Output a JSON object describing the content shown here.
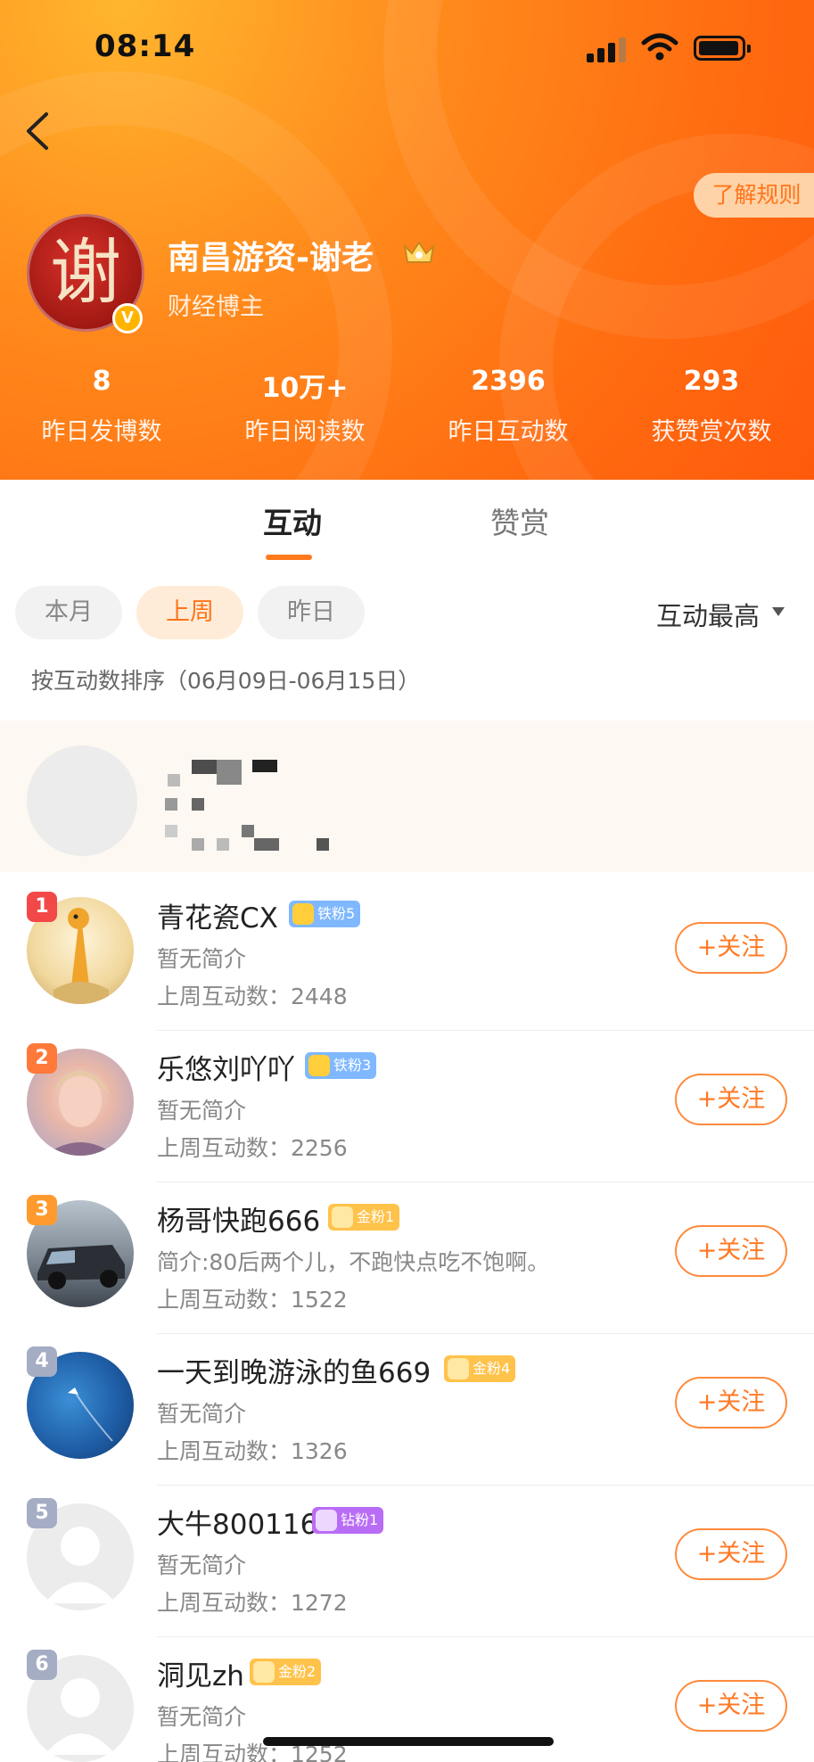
{
  "status_bar": {
    "time": "08:14"
  },
  "header": {
    "rules_button": "了解规则",
    "avatar_char": "谢",
    "name": "南昌游资-谢老",
    "role": "财经博主",
    "stats": [
      {
        "value": "8",
        "label": "昨日发博数"
      },
      {
        "value": "10万+",
        "label": "昨日阅读数"
      },
      {
        "value": "2396",
        "label": "昨日互动数"
      },
      {
        "value": "293",
        "label": "获赞赏次数"
      }
    ]
  },
  "tabs": [
    {
      "label": "互动",
      "active": true
    },
    {
      "label": "赞赏",
      "active": false
    }
  ],
  "filters": {
    "chips": [
      {
        "label": "本月"
      },
      {
        "label": "上周",
        "active": true
      },
      {
        "label": "昨日"
      }
    ],
    "sort_label": "互动最高"
  },
  "sort_description": "按互动数排序（06月09日-06月15日）",
  "fans": [
    {
      "rank": "1",
      "name": "青花瓷CX",
      "badge": "铁粉5",
      "badge_type": "iron",
      "bio": "暂无简介",
      "score": "上周互动数：2448",
      "follow": "+关注"
    },
    {
      "rank": "2",
      "name": "乐悠刘吖吖",
      "badge": "铁粉3",
      "badge_type": "iron",
      "bio": "暂无简介",
      "score": "上周互动数：2256",
      "follow": "+关注"
    },
    {
      "rank": "3",
      "name": "杨哥快跑666",
      "badge": "金粉1",
      "badge_type": "gold",
      "bio": "简介:80后两个儿，不跑快点吃不饱啊。",
      "score": "上周互动数：1522",
      "follow": "+关注"
    },
    {
      "rank": "4",
      "name": "一天到晚游泳的鱼669",
      "badge": "金粉4",
      "badge_type": "gold",
      "bio": "暂无简介",
      "score": "上周互动数：1326",
      "follow": "+关注"
    },
    {
      "rank": "5",
      "name": "大牛800116",
      "badge": "钻粉1",
      "badge_type": "diamond",
      "bio": "暂无简介",
      "score": "上周互动数：1272",
      "follow": "+关注"
    },
    {
      "rank": "6",
      "name": "洞见zh",
      "badge": "金粉2",
      "badge_type": "gold",
      "bio": "暂无简介",
      "score": "上周互动数：1252",
      "follow": "+关注"
    }
  ],
  "colors": {
    "accent": "#ff7a1c",
    "rank1": "#f24848",
    "rank2": "#ff7a3a",
    "rank3": "#ff9a2e",
    "rank_other": "#a5adc4",
    "iron_badge": "#7fb8ff",
    "gold_badge": "#ffc24a",
    "diamond_badge": "#b96cf6"
  }
}
